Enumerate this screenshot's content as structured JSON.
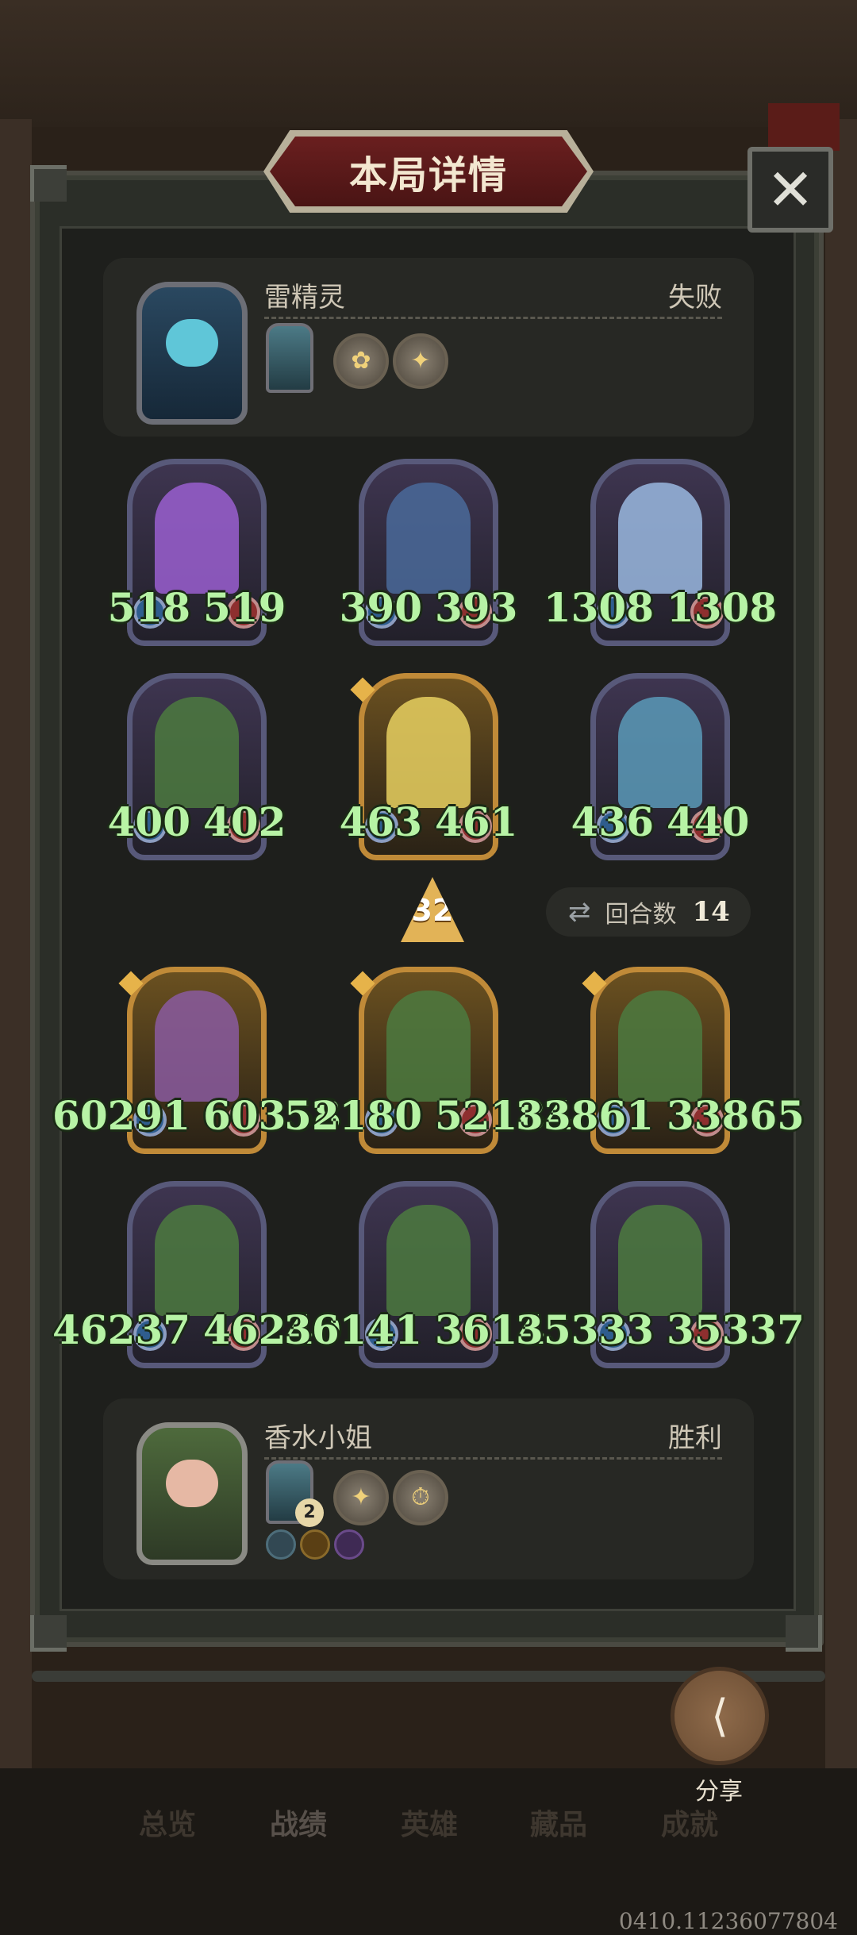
{
  "title": "本局详情",
  "close_icon": "close-icon",
  "top_player": {
    "name": "雷精灵",
    "result": "失败"
  },
  "bottom_player": {
    "name": "香水小姐",
    "result": "胜利",
    "badge": "2"
  },
  "opponent_units": [
    {
      "atk": "518",
      "hp": "519",
      "gold": false,
      "color": "#9a5fd0"
    },
    {
      "atk": "390",
      "hp": "393",
      "gold": false,
      "color": "#4a6a9a"
    },
    {
      "atk": "1308",
      "hp": "1308",
      "gold": false,
      "color": "#9ab8e0"
    },
    {
      "atk": "400",
      "hp": "402",
      "gold": false,
      "color": "#4c7a40"
    },
    {
      "atk": "463",
      "hp": "461",
      "gold": true,
      "color": "#e8d060"
    },
    {
      "atk": "436",
      "hp": "440",
      "gold": false,
      "color": "#5a9ab8"
    }
  ],
  "player_units": [
    {
      "atk": "60291",
      "hp": "60358",
      "gold": true,
      "color": "#8a5aa0"
    },
    {
      "atk": "52180",
      "hp": "52184",
      "gold": true,
      "color": "#4c7a40"
    },
    {
      "atk": "33861",
      "hp": "33865",
      "gold": true,
      "color": "#4c7a40"
    },
    {
      "atk": "46237",
      "hp": "46240",
      "gold": false,
      "color": "#4c7a40"
    },
    {
      "atk": "36141",
      "hp": "36145",
      "gold": false,
      "color": "#4c7a40"
    },
    {
      "atk": "35333",
      "hp": "35337",
      "gold": false,
      "color": "#4c7a40"
    }
  ],
  "level": "32",
  "round": {
    "label": "回合数",
    "value": "14"
  },
  "share_label": "分享",
  "tabs": [
    "总览",
    "战绩",
    "英雄",
    "藏品",
    "成就"
  ],
  "version": "0410.11236077804"
}
